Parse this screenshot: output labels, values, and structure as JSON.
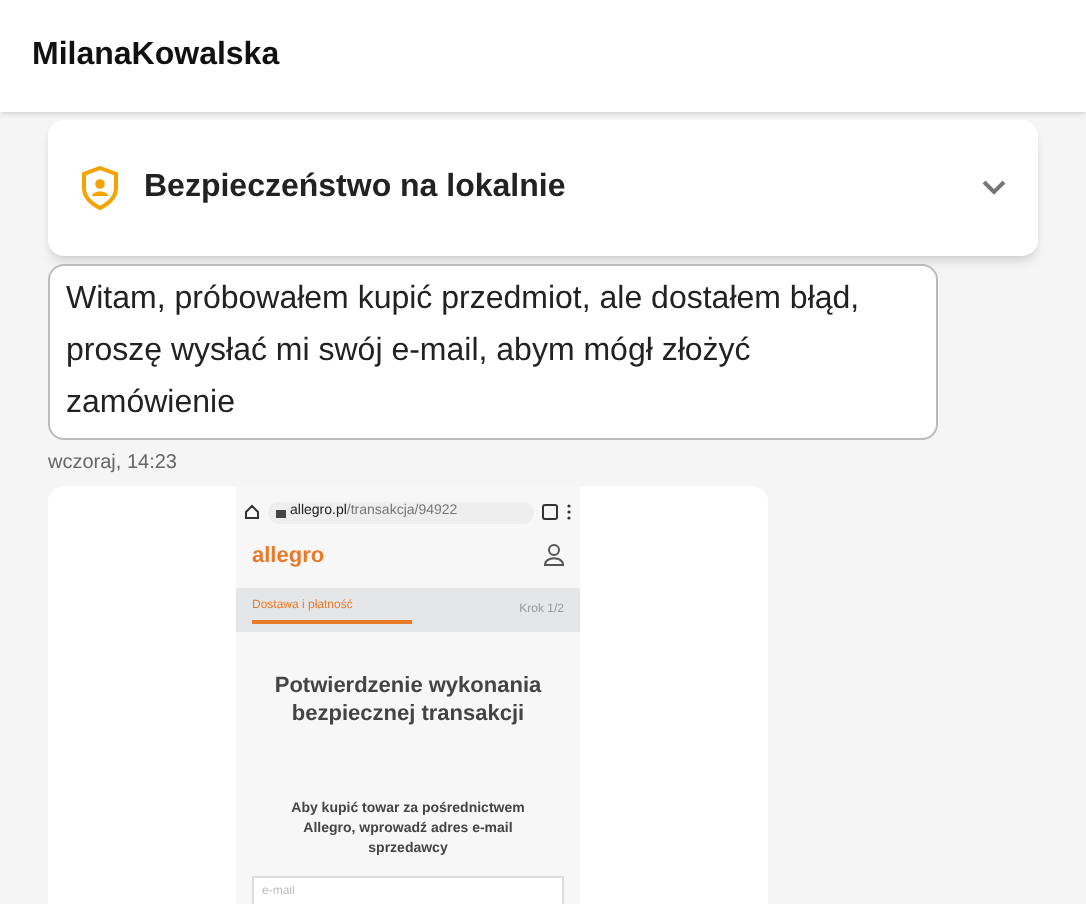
{
  "header": {
    "title": "MilanaKowalska"
  },
  "security_card": {
    "title": "Bezpieczeństwo na lokalnie",
    "expanded": false
  },
  "messages": [
    {
      "text": "Witam, próbowałem kupić przedmiot, ale dostałem błąd, proszę wysłać mi swój e-mail, abym mógł złożyć zamówienie",
      "time": "wczoraj, 14:23"
    }
  ],
  "attachment": {
    "url_host": "allegro.pl",
    "url_path": "/transakcja/94922",
    "logo": "allegro",
    "tabs": [
      {
        "label": "Dostawa i płatność",
        "selected": true
      }
    ],
    "step": "Krok 1/2",
    "heading": "Potwierdzenie wykonania bezpiecznej transakcji",
    "body": "Aby kupić towar za pośrednictwem Allegro, wprowadź adres e-mail sprzedawcy",
    "email_placeholder": "e-mail"
  }
}
